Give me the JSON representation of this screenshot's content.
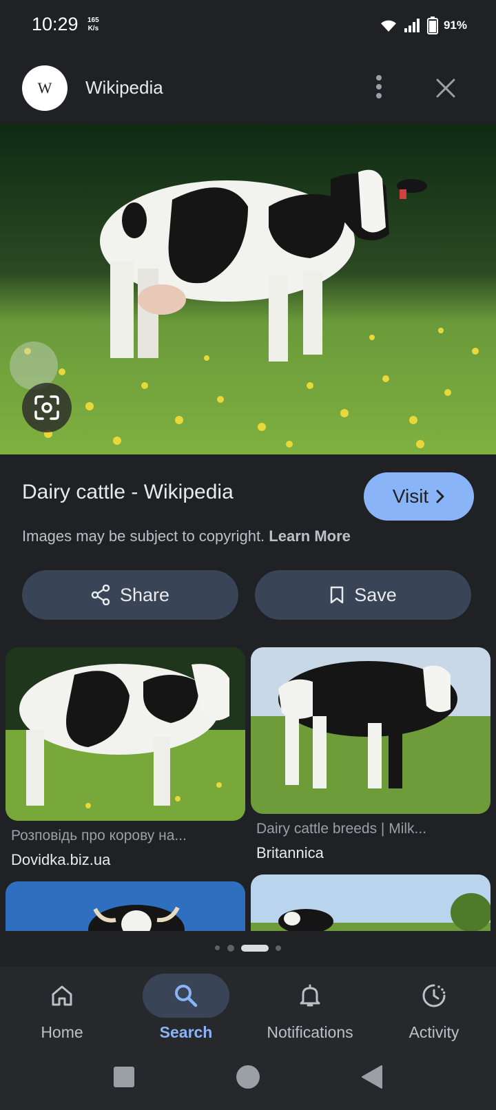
{
  "status_bar": {
    "time": "10:29",
    "speed_value": "165",
    "speed_unit": "K/s",
    "battery_percent": "91%",
    "icons": [
      "wifi-icon",
      "signal-icon",
      "battery-icon"
    ]
  },
  "header": {
    "logo_letter": "W",
    "site_name": "Wikipedia",
    "icons": [
      "more-vert-icon",
      "close-icon"
    ]
  },
  "result": {
    "title": "Dairy cattle - Wikipedia",
    "visit_label": "Visit",
    "copyright_text": "Images may be subject to copyright.",
    "learn_more": "Learn More",
    "share_label": "Share",
    "save_label": "Save"
  },
  "related": [
    {
      "caption": "Розповідь про корову на...",
      "source": "Dovidka.biz.ua"
    },
    {
      "caption": "Dairy cattle breeds | Milk...",
      "source": "Britannica"
    }
  ],
  "bottom_nav": [
    {
      "label": "Home",
      "icon": "home-icon"
    },
    {
      "label": "Search",
      "icon": "search-icon",
      "active": true
    },
    {
      "label": "Notifications",
      "icon": "bell-icon"
    },
    {
      "label": "Activity",
      "icon": "activity-icon"
    }
  ],
  "colors": {
    "background": "#202124",
    "accent": "#8ab4f8",
    "button_bg": "#394457"
  }
}
